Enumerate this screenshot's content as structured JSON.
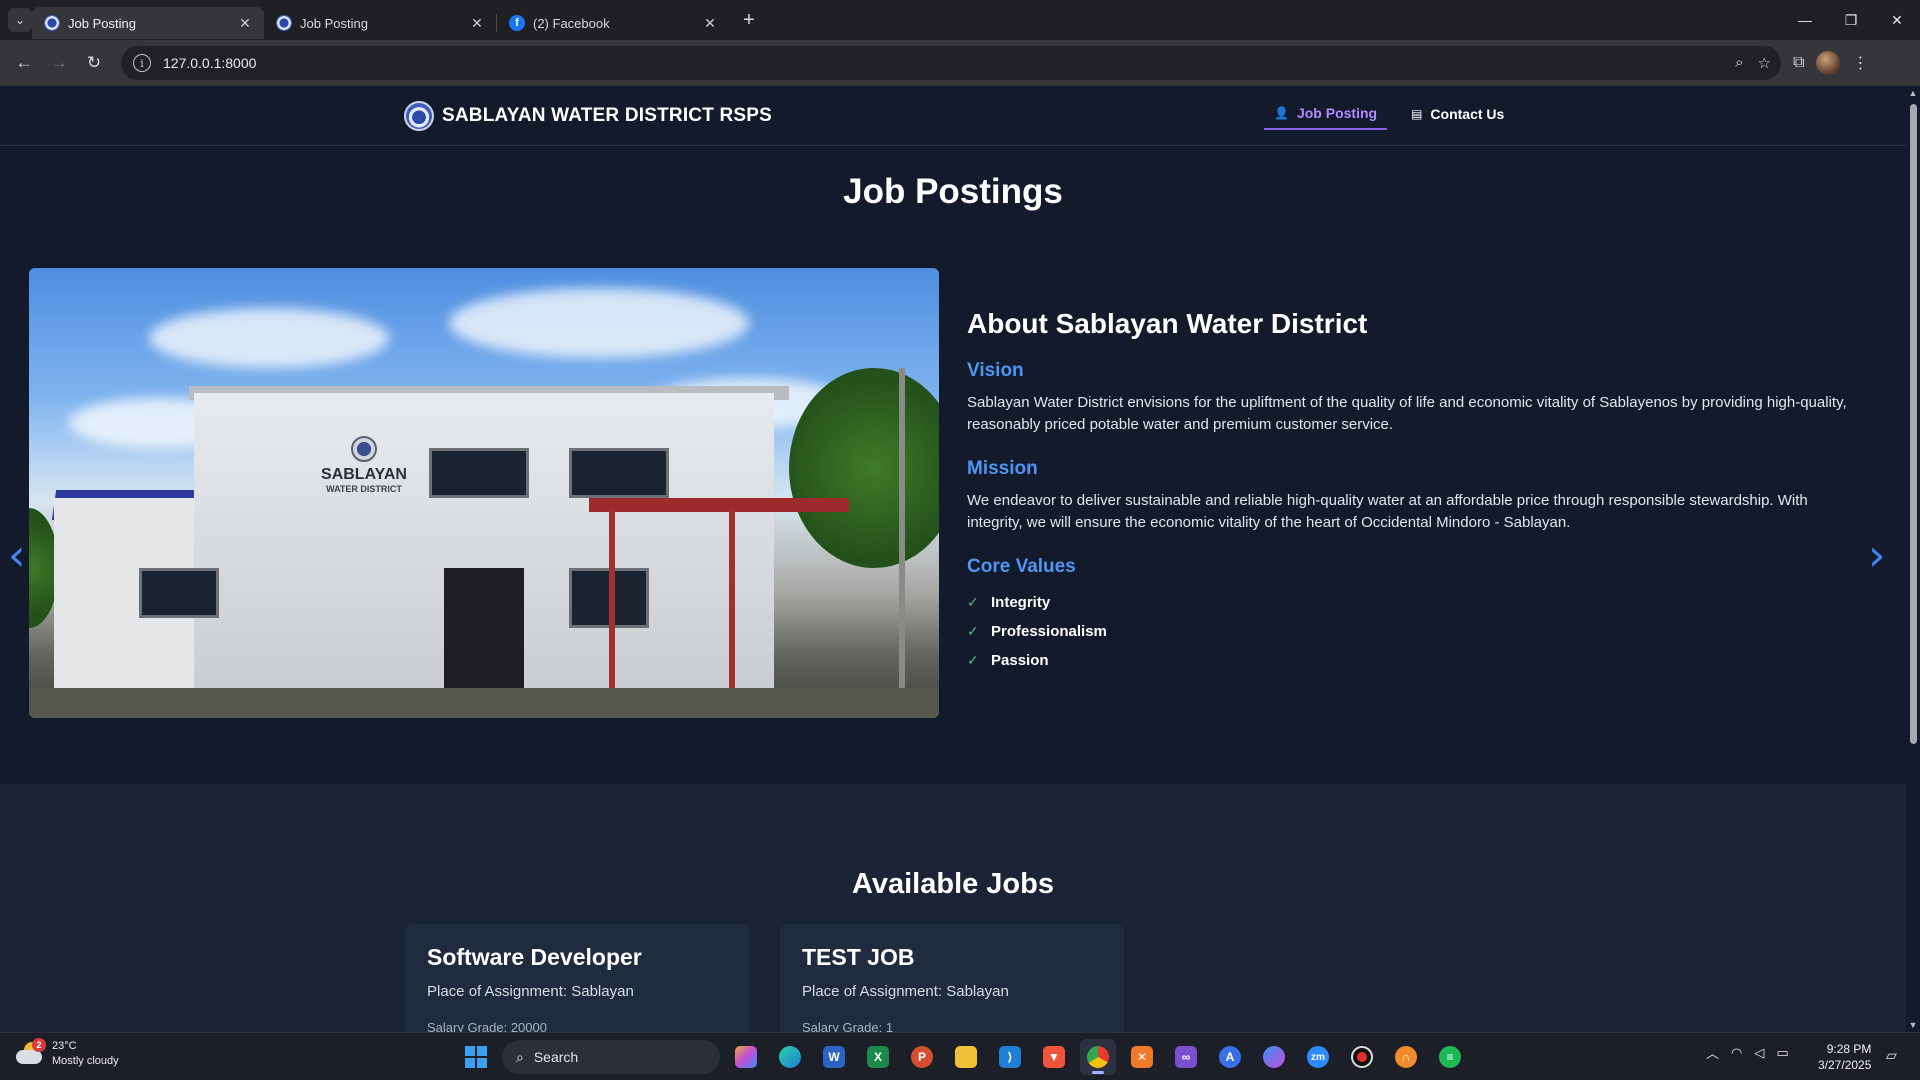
{
  "browser": {
    "tabs": [
      {
        "title": "Job Posting",
        "active": true
      },
      {
        "title": "Job Posting",
        "active": false
      },
      {
        "title": "(2) Facebook",
        "active": false
      }
    ],
    "url": "127.0.0.1:8000",
    "icons": {
      "tab_list": "chevron-down-icon",
      "new_tab": "plus-icon",
      "back": "back-arrow-icon",
      "forward": "forward-arrow-icon",
      "reload": "reload-icon",
      "site_info": "info-icon",
      "zoom": "zoom-icon",
      "bookmark": "star-icon",
      "extensions": "puzzle-icon",
      "menu": "kebab-menu-icon"
    }
  },
  "site": {
    "brand": "SABLAYAN WATER DISTRICT RSPS",
    "nav": [
      {
        "label": "Job Posting",
        "icon": "user-icon",
        "active": true
      },
      {
        "label": "Contact Us",
        "icon": "id-card-icon",
        "active": false
      }
    ],
    "page_title": "Job Postings",
    "accent_color": "#8a63e8",
    "heading_blue": "#4f95f2"
  },
  "hero": {
    "photo_sign": "SABLAYAN",
    "photo_sign_sub": "WATER DISTRICT",
    "about_title": "About Sablayan Water District",
    "vision_title": "Vision",
    "vision_text": "Sablayan Water District envisions for the upliftment of the quality of life and economic vitality of Sablayenos by providing high-quality, reasonably priced potable water and premium customer service.",
    "mission_title": "Mission",
    "mission_text": "We endeavor to deliver sustainable and reliable high-quality water at an affordable price through responsible stewardship. With integrity, we will ensure the economic vitality of the heart of Occidental Mindoro - Sablayan.",
    "values_title": "Core Values",
    "values": [
      "Integrity",
      "Professionalism",
      "Passion"
    ]
  },
  "jobs": {
    "title": "Available Jobs",
    "cards": [
      {
        "title": "Software Developer",
        "place": "Place of Assignment: Sablayan",
        "grade": "Salary Grade: 20000"
      },
      {
        "title": "TEST JOB",
        "place": "Place of Assignment: Sablayan",
        "grade": "Salary Grade: 1"
      }
    ]
  },
  "taskbar": {
    "weather_temp": "23°C",
    "weather_desc": "Mostly cloudy",
    "weather_badge": "2",
    "search_label": "Search",
    "time": "9:28 PM",
    "date": "3/27/2025"
  }
}
